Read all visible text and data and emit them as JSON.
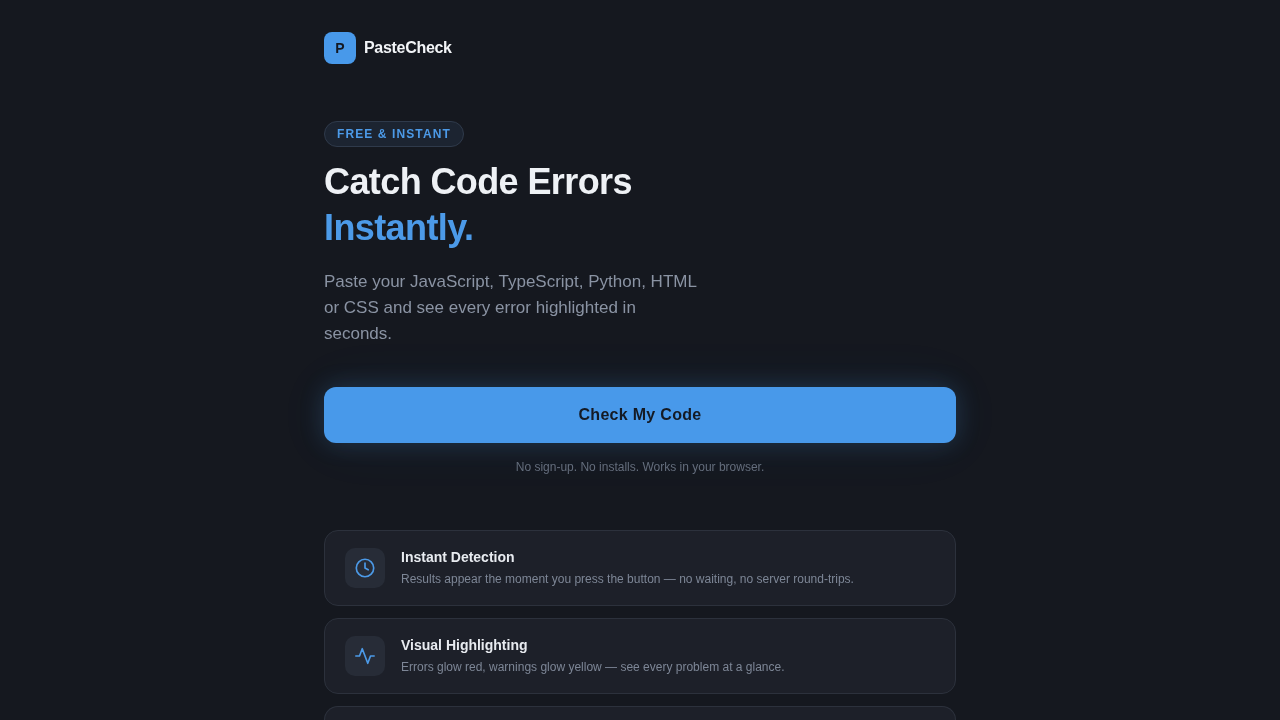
{
  "brand": {
    "logo_letter": "P",
    "name": "PasteCheck"
  },
  "hero": {
    "badge": "FREE & INSTANT",
    "title": "Catch Code Errors",
    "title_accent": "Instantly.",
    "description": "Paste your JavaScript, TypeScript, Python, HTML or CSS and see every error highlighted in seconds."
  },
  "cta": {
    "button": "Check My Code",
    "note": "No sign-up. No installs. Works in your browser."
  },
  "features": [
    {
      "kind": "clock",
      "title": "Instant Detection",
      "description": "Results appear the moment you press the button — no waiting, no server round-trips."
    },
    {
      "kind": "pulse",
      "title": "Visual Highlighting",
      "description": "Errors glow red, warnings glow yellow — see every problem at a glance."
    },
    {
      "kind": "partial"
    }
  ]
}
